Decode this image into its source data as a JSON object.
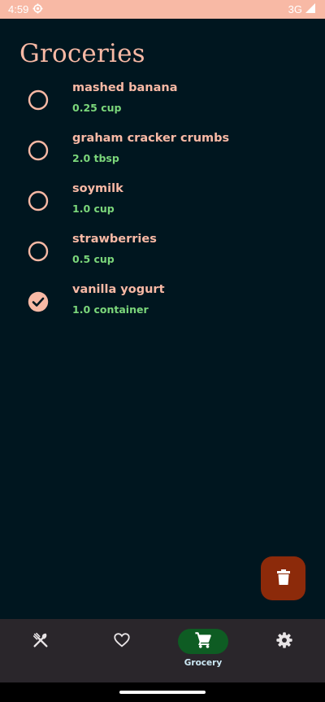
{
  "status_bar": {
    "time": "4:59",
    "network": "3G"
  },
  "page": {
    "title": "Groceries"
  },
  "groceries": [
    {
      "name": "mashed banana",
      "quantity": "0.25 cup",
      "checked": false
    },
    {
      "name": "graham cracker crumbs",
      "quantity": "2.0 tbsp",
      "checked": false
    },
    {
      "name": "soymilk",
      "quantity": "1.0 cup",
      "checked": false
    },
    {
      "name": "strawberries",
      "quantity": "0.5 cup",
      "checked": false
    },
    {
      "name": "vanilla yogurt",
      "quantity": "1.0 container",
      "checked": true
    }
  ],
  "fab": {
    "icon": "trash-icon"
  },
  "nav": {
    "items": [
      {
        "icon": "utensils-icon",
        "label": "",
        "active": false
      },
      {
        "icon": "heart-icon",
        "label": "",
        "active": false
      },
      {
        "icon": "cart-icon",
        "label": "Grocery",
        "active": true
      },
      {
        "icon": "gear-icon",
        "label": "",
        "active": false
      }
    ]
  },
  "colors": {
    "background": "#00161f",
    "accent": "#f8b9a5",
    "quantity": "#7bd77b",
    "fab": "#8c2a0a",
    "nav_background": "#2a262b",
    "nav_active": "#0e5c23"
  }
}
